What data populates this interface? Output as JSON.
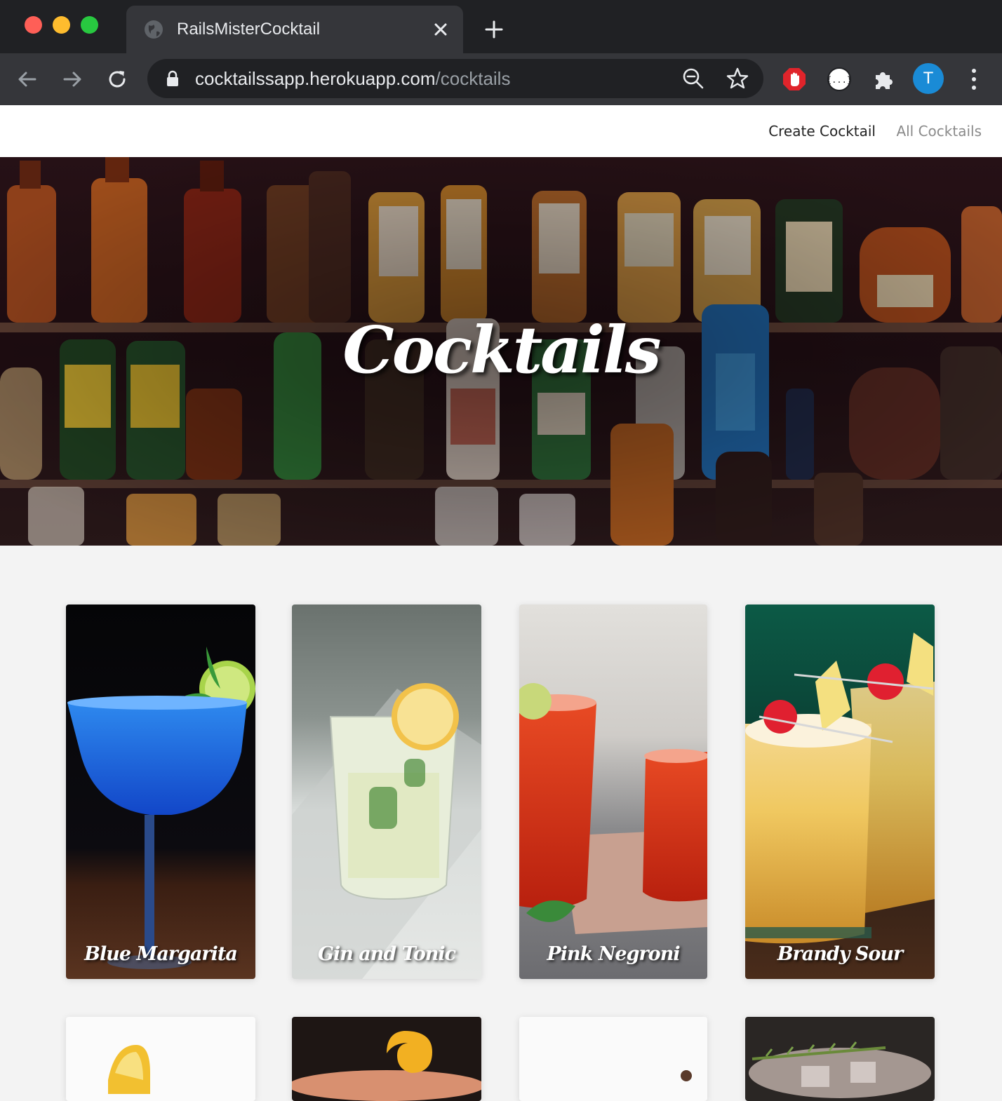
{
  "browser": {
    "tab_title": "RailsMisterCocktail",
    "url_host": "cocktailssapp.herokuapp.com",
    "url_path": "/cocktails",
    "profile_initial": "T"
  },
  "nav": {
    "create_label": "Create Cocktail",
    "all_label": "All Cocktails"
  },
  "hero": {
    "title": "Cocktails"
  },
  "cocktails": [
    {
      "name": "Blue Margarita"
    },
    {
      "name": "Gin and Tonic"
    },
    {
      "name": "Pink Negroni"
    },
    {
      "name": "Brandy Sour"
    }
  ],
  "colors": {
    "chrome_dark": "#202124",
    "chrome_toolbar": "#35363a",
    "page_bg": "#f3f3f3",
    "profile_blue": "#1a8bd6"
  }
}
